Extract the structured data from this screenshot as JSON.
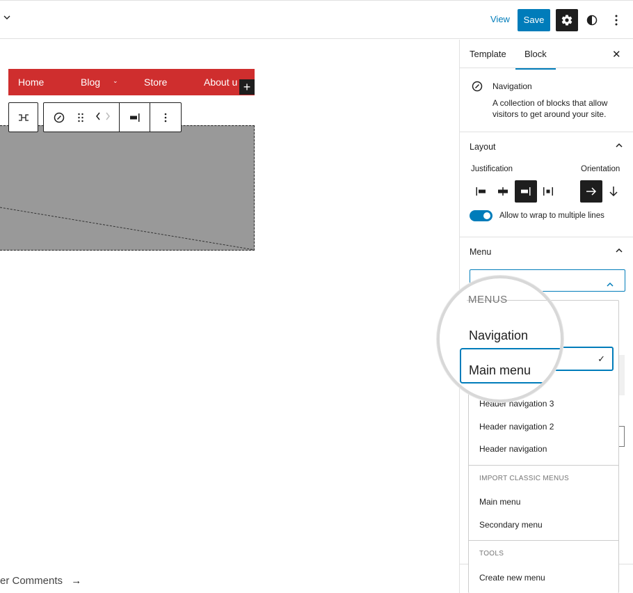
{
  "topbar": {
    "view_label": "View",
    "save_label": "Save"
  },
  "canvas": {
    "nav_items": [
      "Home",
      "Blog",
      "Store",
      "About u"
    ],
    "footer_link": "er Comments",
    "footer_arrow": "→"
  },
  "sidebar": {
    "tabs": [
      "Template",
      "Block"
    ],
    "active_tab": "Block",
    "block": {
      "title": "Navigation",
      "description": "A collection of blocks that allow visitors to get around your site."
    },
    "layout": {
      "title": "Layout",
      "justification_label": "Justification",
      "orientation_label": "Orientation",
      "justification_options": [
        "left",
        "center",
        "right",
        "space-between"
      ],
      "justification_selected": "right",
      "orientation_options": [
        "horizontal",
        "vertical"
      ],
      "orientation_selected": "horizontal",
      "wrap_label": "Allow to wrap to multiple lines",
      "wrap_enabled": true
    },
    "menu": {
      "title": "Menu"
    }
  },
  "dropdown": {
    "menus_heading": "MENUS",
    "menus": [
      "Navigation",
      "Main menu",
      "Header navigation 3",
      "Header navigation 2",
      "Header navigation"
    ],
    "selected": "Main menu",
    "import_heading": "IMPORT CLASSIC MENUS",
    "classic_menus": [
      "Main menu",
      "Secondary menu"
    ],
    "tools_heading": "TOOLS",
    "tools": [
      "Create new menu"
    ],
    "check_glyph": "✓"
  },
  "colors": {
    "accent": "#007cba",
    "nav_background": "#cf2e2e",
    "dark": "#1e1e1e"
  }
}
